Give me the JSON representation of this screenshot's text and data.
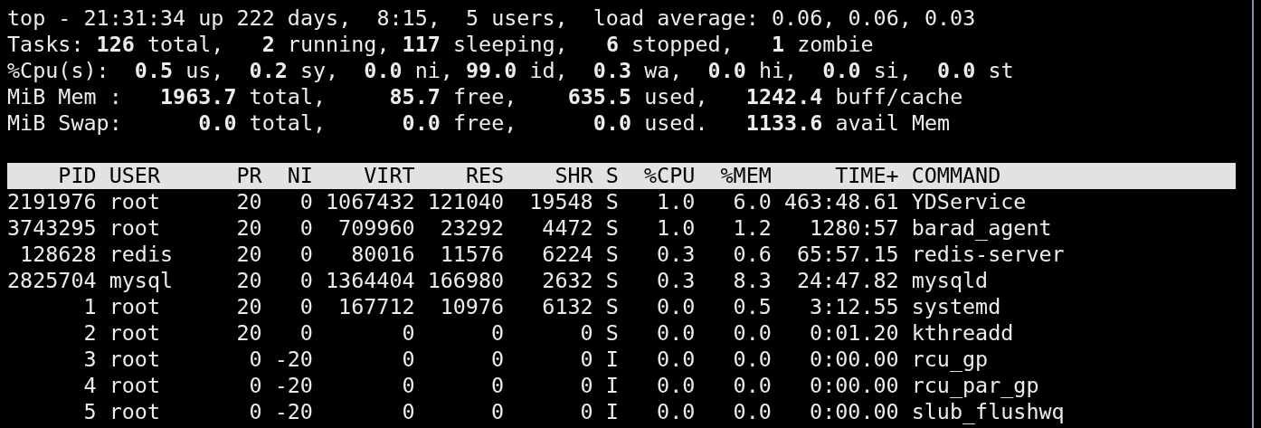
{
  "summary": [
    "top - 21:31:34 up 222 days,  8:15,  5 users,  load average: 0.06, 0.06, 0.03",
    "Tasks: **126** total,   **2** running, **117** sleeping,   **6** stopped,   **1** zombie",
    "%Cpu(s):  **0.5** us,  **0.2** sy,  **0.0** ni, **99.0** id,  **0.3** wa,  **0.0** hi,  **0.0** si,  **0.0** st",
    "MiB Mem :   **1963.7** total,     **85.7** free,    **635.5** used,   **1242.4** buff/cache",
    "MiB Swap:      **0.0** total,      **0.0** free,      **0.0** used.   **1133.6** avail Mem"
  ],
  "table": {
    "columns": [
      "PID",
      "USER",
      "PR",
      "NI",
      "VIRT",
      "RES",
      "SHR",
      "S",
      "%CPU",
      "%MEM",
      "TIME+",
      "COMMAND"
    ],
    "rows": [
      [
        "2191976",
        "root",
        "20",
        "0",
        "1067432",
        "121040",
        "19548",
        "S",
        "1.0",
        "6.0",
        "463:48.61",
        "YDService"
      ],
      [
        "3743295",
        "root",
        "20",
        "0",
        "709960",
        "23292",
        "4472",
        "S",
        "1.0",
        "1.2",
        "1280:57",
        "barad_agent"
      ],
      [
        "128628",
        "redis",
        "20",
        "0",
        "80016",
        "11576",
        "6224",
        "S",
        "0.3",
        "0.6",
        "65:57.15",
        "redis-server"
      ],
      [
        "2825704",
        "mysql",
        "20",
        "0",
        "1364404",
        "166980",
        "2632",
        "S",
        "0.3",
        "8.3",
        "24:47.82",
        "mysqld"
      ],
      [
        "1",
        "root",
        "20",
        "0",
        "167712",
        "10976",
        "6132",
        "S",
        "0.0",
        "0.5",
        "3:12.55",
        "systemd"
      ],
      [
        "2",
        "root",
        "20",
        "0",
        "0",
        "0",
        "0",
        "S",
        "0.0",
        "0.0",
        "0:01.20",
        "kthreadd"
      ],
      [
        "3",
        "root",
        "0",
        "-20",
        "0",
        "0",
        "0",
        "I",
        "0.0",
        "0.0",
        "0:00.00",
        "rcu_gp"
      ],
      [
        "4",
        "root",
        "0",
        "-20",
        "0",
        "0",
        "0",
        "I",
        "0.0",
        "0.0",
        "0:00.00",
        "rcu_par_gp"
      ],
      [
        "5",
        "root",
        "0",
        "-20",
        "0",
        "0",
        "0",
        "I",
        "0.0",
        "0.0",
        "0:00.00",
        "slub_flushwq"
      ]
    ]
  }
}
